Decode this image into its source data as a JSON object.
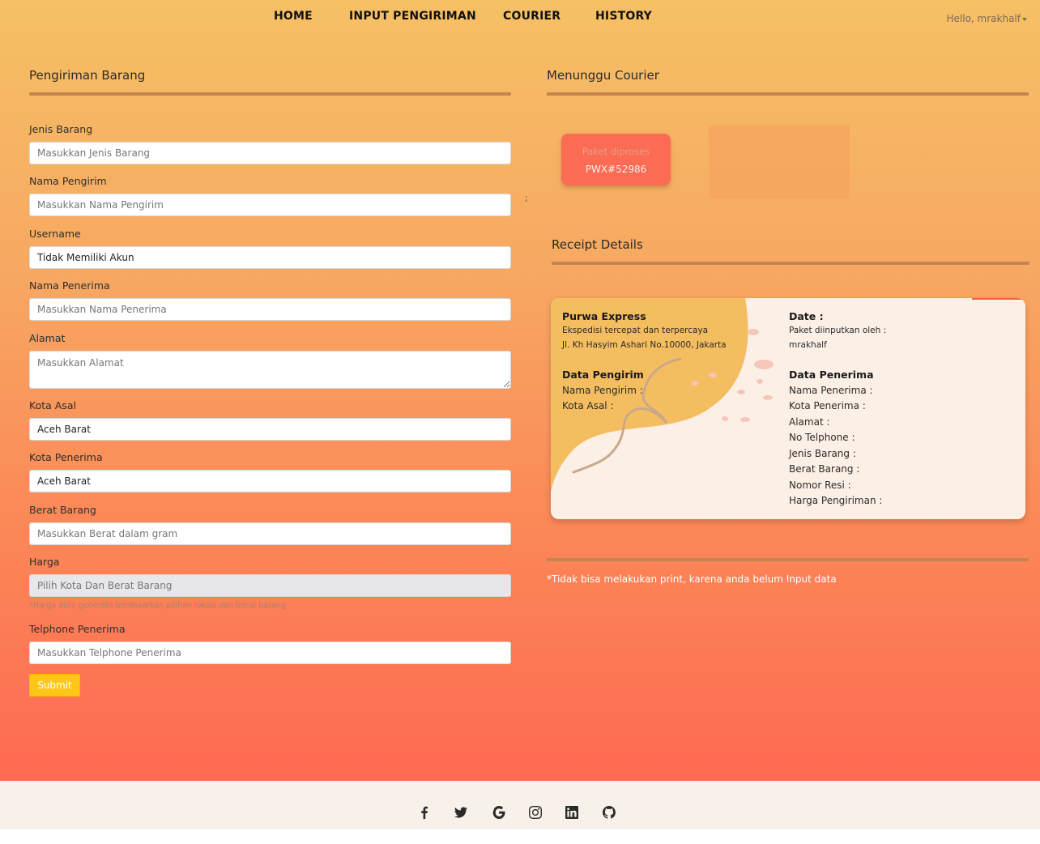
{
  "nav": {
    "items": [
      {
        "label": "HOME"
      },
      {
        "label": "INPUT PENGIRIMAN"
      },
      {
        "label": "COURIER"
      },
      {
        "label": "HISTORY"
      }
    ],
    "user_greeting": "Hello, mrakhalf"
  },
  "form": {
    "title": "Pengiriman Barang",
    "jenis_barang": {
      "label": "Jenis Barang",
      "placeholder": "Masukkan Jenis Barang",
      "value": ""
    },
    "nama_pengirim": {
      "label": "Nama Pengirim",
      "placeholder": "Masukkan Nama Pengirim",
      "value": ""
    },
    "username": {
      "label": "Username",
      "value": "Tidak Memiliki Akun"
    },
    "nama_penerima": {
      "label": "Nama Penerima",
      "placeholder": "Masukkan Nama Penerima",
      "value": ""
    },
    "alamat": {
      "label": "Alamat",
      "placeholder": "Masukkan Alamat",
      "value": ""
    },
    "kota_asal": {
      "label": "Kota Asal",
      "value": "Aceh Barat"
    },
    "kota_penerima": {
      "label": "Kota Penerima",
      "value": "Aceh Barat"
    },
    "berat_barang": {
      "label": "Berat Barang",
      "placeholder": "Masukkan Berat dalam gram",
      "value": ""
    },
    "harga": {
      "label": "Harga",
      "placeholder": "Pilih Kota Dan Berat Barang",
      "hint": "*Harga auto generate berdasarkan pilihan lokasi dan berat barang"
    },
    "telphone": {
      "label": "Telphone Penerima",
      "placeholder": "Masukkan Telphone Penerima",
      "value": ""
    },
    "submit_label": "Submit"
  },
  "courier": {
    "title": "Menunggu Courier",
    "package_status": "Paket diproses",
    "package_code": "PWX#52986",
    "stray_text": ";"
  },
  "receipt": {
    "title": "Receipt Details",
    "company": "Purwa Express",
    "tagline": "Ekspedisi tercepat dan terpercaya",
    "address": "Jl. Kh Hasyim Ashari No.10000, Jakarta",
    "date_label": "Date :",
    "input_by": "Paket diinputkan oleh :",
    "input_user": "mrakhalf",
    "sender_heading": "Data Pengirim",
    "sender_fields": [
      "Nama Pengirim :",
      "Kota Asal :"
    ],
    "receiver_heading": "Data Penerima",
    "receiver_fields": [
      "Nama Penerima :",
      "Kota Penerima :",
      "Alamat :",
      "No Telphone :",
      "Jenis Barang :",
      "Berat Barang :",
      "Nomor Resi :",
      "Harga Pengiriman :"
    ],
    "print_note": "*Tidak bisa melakukan print, karena anda belum Input data"
  },
  "footer": {
    "icons": [
      "facebook-icon",
      "twitter-icon",
      "google-icon",
      "instagram-icon",
      "linkedin-icon",
      "github-icon"
    ]
  },
  "colors": {
    "gradient_top": "#f6c065",
    "gradient_bottom": "#fe6a52",
    "rule": "#c5854e",
    "submit": "#ffc61a",
    "package_card": "#fc6b53",
    "receipt_bg": "#fbefe6",
    "receipt_blob": "#f4bd5f",
    "footer_bg": "#f8f1e9"
  }
}
